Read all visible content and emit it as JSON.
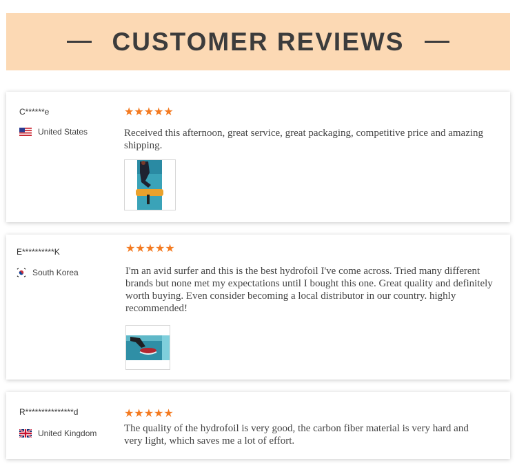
{
  "header": {
    "title": "CUSTOMER REVIEWS"
  },
  "reviews": [
    {
      "name": "C******e",
      "country": "United States",
      "flag_icon": "us-flag-icon",
      "rating": "★★★★★",
      "text": "Received this afternoon, great service, great packaging, competitive price and amazing shipping.",
      "has_photo": true
    },
    {
      "name": "E**********K",
      "country": "South Korea",
      "flag_icon": "kr-flag-icon",
      "rating": "★★★★★",
      "text": "I'm an avid surfer and this is the best hydrofoil I've come across. Tried many different brands but none met my expectations until I bought this one. Great quality and definitely worth buying. Even consider becoming a local distributor in our country. highly recommended!",
      "has_photo": true
    },
    {
      "name": "R***************d",
      "country": "United Kingdom",
      "flag_icon": "uk-flag-icon",
      "rating": "★★★★★",
      "text": "The quality of the hydrofoil is very good, the carbon fiber material is very hard and very light, which saves me a lot of effort.",
      "has_photo": false
    }
  ],
  "colors": {
    "banner_bg": "#fcd9b4",
    "star": "#f47a20",
    "title": "#3c3c3c"
  }
}
